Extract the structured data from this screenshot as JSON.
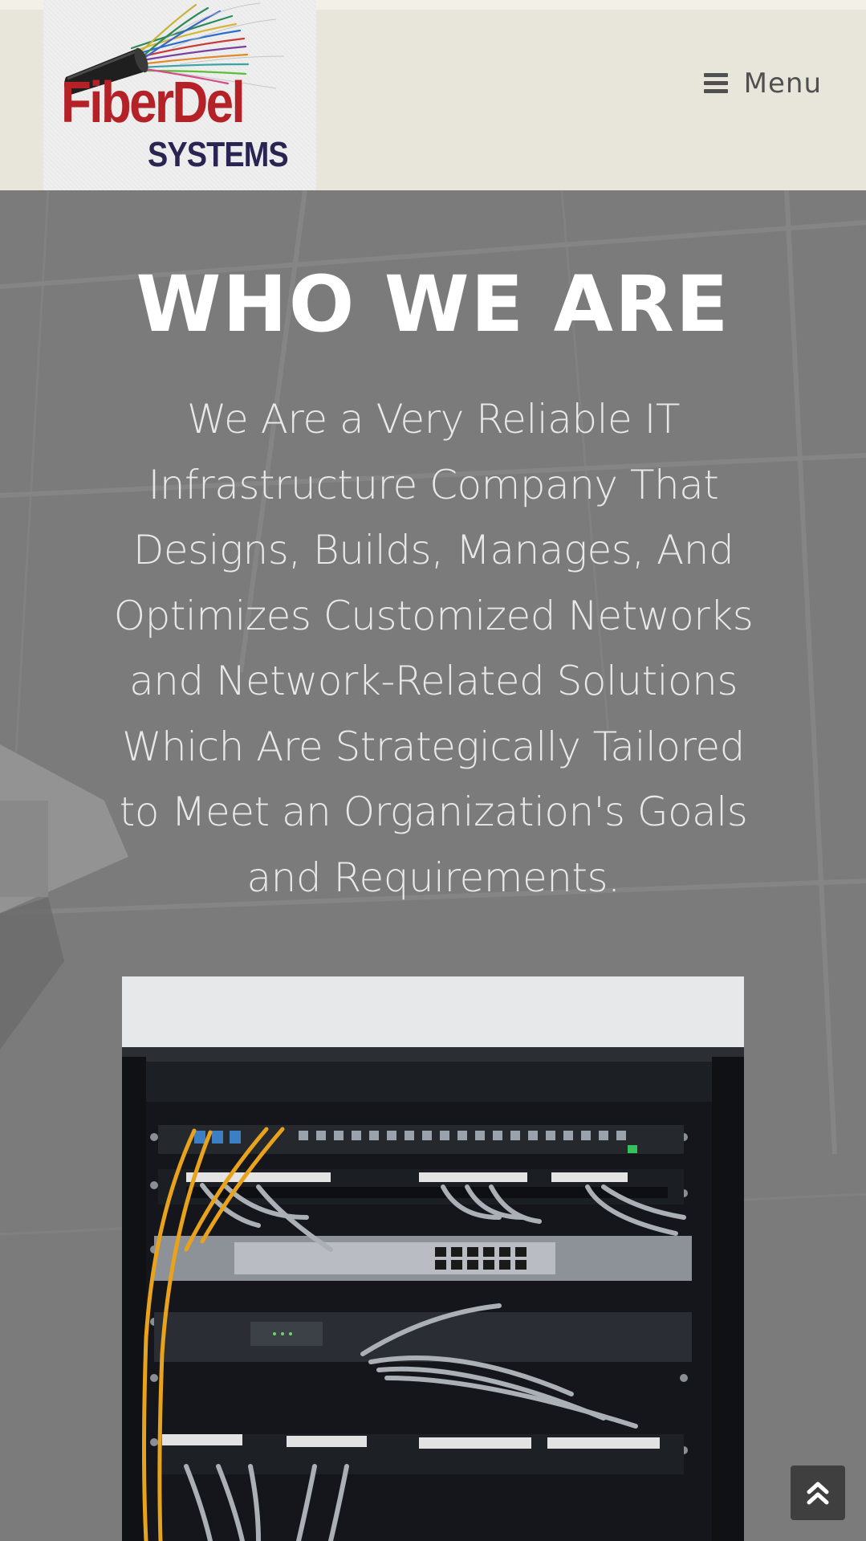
{
  "header": {
    "logo": {
      "word1": "FiberDel",
      "word2": "SYSTEMS"
    },
    "menu": {
      "icon": "hamburger-icon",
      "label": "Menu"
    }
  },
  "hero": {
    "title": "WHO WE ARE",
    "description": "We Are a Very Reliable IT Infrastructure Company That Designs, Builds, Manages, And Optimizes Customized Networks and Network-Related Solutions Which Are Strategically Tailored to Meet an Organization's Goals and Requirements."
  },
  "image": {
    "subject": "network-rack-photo"
  },
  "scroll_top": {
    "icon": "double-chevron-up-icon"
  },
  "colors": {
    "header_bg": "#e8e6da",
    "logo_red": "#b42127",
    "logo_navy": "#2a2452",
    "hero_overlay": "#7c7c7c",
    "title_color": "#ffffff",
    "text_color": "#e8e8e8",
    "cable_yellow": "#e8a21c"
  }
}
